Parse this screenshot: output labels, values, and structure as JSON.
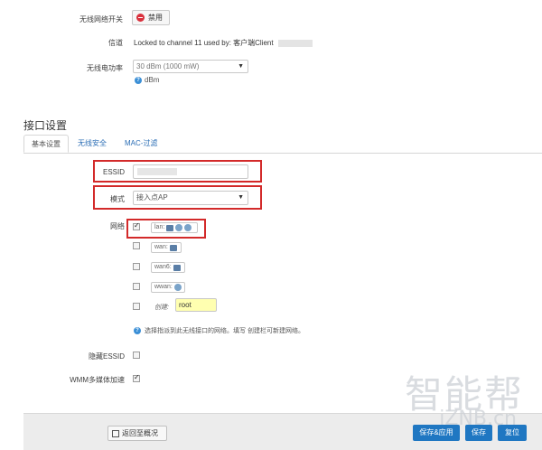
{
  "wireless": {
    "switch_label": "无线网络开关",
    "disable_button": "禁用",
    "channel_label": "信道",
    "channel_value": "Locked to channel 11 used by: 客户端Client",
    "power_label": "无线电功率",
    "power_value": "30 dBm (1000 mW)",
    "power_unit": "dBm"
  },
  "interface": {
    "title": "接口设置",
    "tabs": [
      "基本设置",
      "无线安全",
      "MAC-过滤"
    ],
    "essid_label": "ESSID",
    "essid_value": "",
    "mode_label": "模式",
    "mode_value": "接入点AP",
    "network_label": "网络",
    "networks": [
      {
        "name": "lan:",
        "checked": true
      },
      {
        "name": "wan:",
        "checked": false
      },
      {
        "name": "wan6:",
        "checked": false
      },
      {
        "name": "wwan:",
        "checked": false
      }
    ],
    "create_label": "创建:",
    "create_value": "root",
    "network_help": "选择指派到此无线接口的网络。填写 创建栏可新建网络。",
    "hide_essid_label": "隐藏ESSID",
    "wmm_label": "WMM多媒体加速"
  },
  "footer": {
    "back_button": "返回至概况",
    "save_apply": "保存&应用",
    "save": "保存",
    "reset": "复位"
  },
  "watermark": {
    "text": "智能帮",
    "sub": "iZNB.cn"
  },
  "colors": {
    "primary": "#1f77c2",
    "highlight": "#d32a2a",
    "create_input_bg": "#ffffb0"
  }
}
